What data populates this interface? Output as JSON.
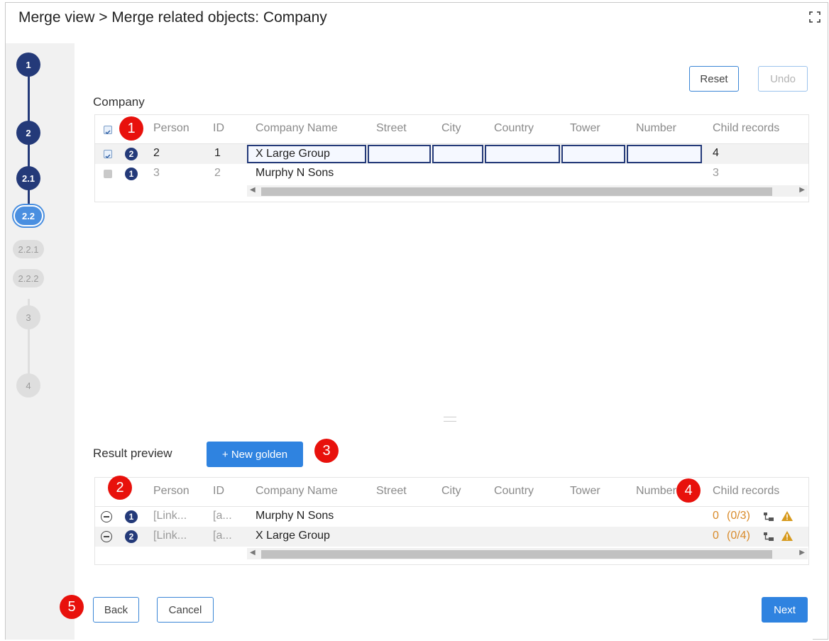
{
  "header": {
    "title": "Merge view > Merge related objects: Company"
  },
  "steps": [
    {
      "label": "1",
      "state": "done"
    },
    {
      "label": "2",
      "state": "done"
    },
    {
      "label": "2.1",
      "state": "done"
    },
    {
      "label": "2.2",
      "state": "current"
    },
    {
      "label": "2.2.1",
      "state": "pending"
    },
    {
      "label": "2.2.2",
      "state": "pending"
    },
    {
      "label": "3",
      "state": "pending"
    },
    {
      "label": "4",
      "state": "pending"
    }
  ],
  "toolbar": {
    "reset_label": "Reset",
    "undo_label": "Undo"
  },
  "company": {
    "title": "Company",
    "columns": [
      "Person",
      "ID",
      "Company Name",
      "Street",
      "City",
      "Country",
      "Tower",
      "Number",
      "Child records"
    ],
    "rows": [
      {
        "checked": true,
        "badge": "2",
        "person": "2",
        "id": "1",
        "company_name": "X Large Group",
        "child_records": "4"
      },
      {
        "checked": false,
        "badge": "1",
        "person": "3",
        "id": "2",
        "company_name": "Murphy N Sons",
        "child_records": "3"
      }
    ]
  },
  "preview": {
    "title": "Result preview",
    "new_golden_label": "+ New golden",
    "columns": [
      "Person",
      "ID",
      "Company Name",
      "Street",
      "City",
      "Country",
      "Tower",
      "Number",
      "Child records"
    ],
    "rows": [
      {
        "badge": "1",
        "person": "[Link...",
        "id": "[a...",
        "company_name": "Murphy N Sons",
        "child_records": "0",
        "child_detail": "(0/3)"
      },
      {
        "badge": "2",
        "person": "[Link...",
        "id": "[a...",
        "company_name": "X Large Group",
        "child_records": "0",
        "child_detail": "(0/4)"
      }
    ]
  },
  "callouts": [
    "1",
    "2",
    "3",
    "4",
    "5"
  ],
  "footer": {
    "back_label": "Back",
    "cancel_label": "Cancel",
    "next_label": "Next"
  },
  "colors": {
    "accent": "#2f83e0",
    "step_done": "#243a79",
    "callout": "#e8110c",
    "warning": "#d98b2b"
  },
  "icons": [
    "fullscreen-icon",
    "checkbox-icon",
    "remove-circle-icon",
    "hierarchy-icon",
    "warning-icon"
  ]
}
